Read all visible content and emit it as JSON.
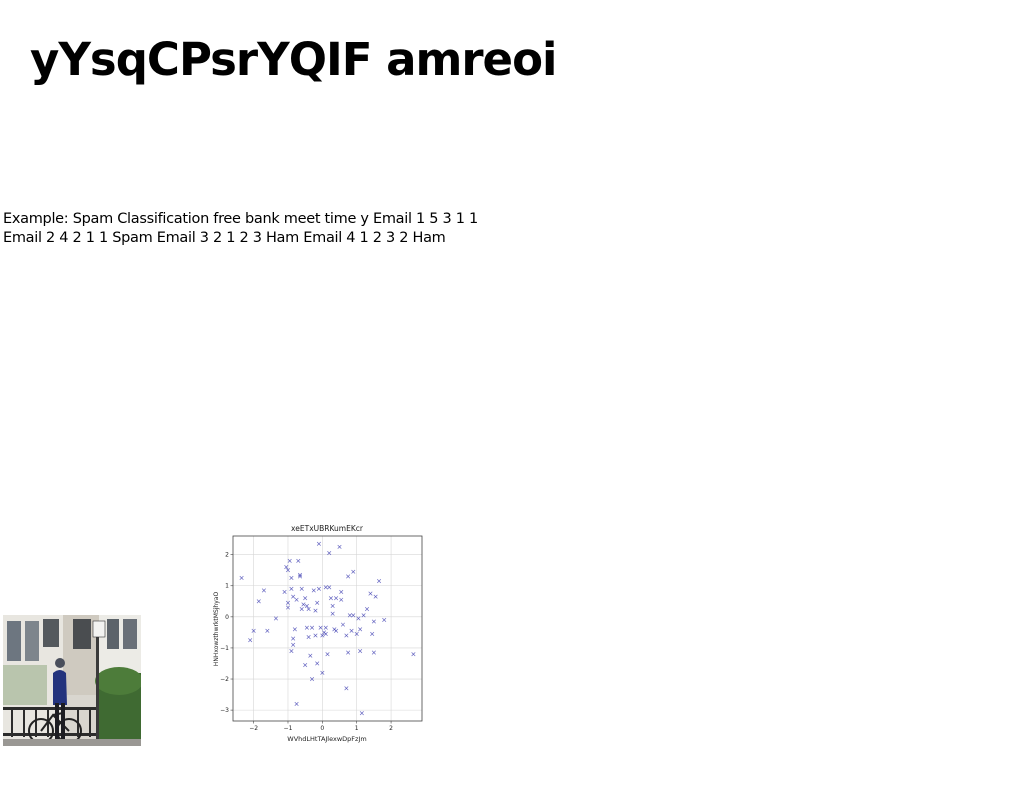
{
  "title": "yYsqCPsrYQIF amreoi",
  "body_text": "Example: Spam Classification free bank meet time y Email 1 5 3 1 1 Email 2 4 2 1 1 Spam Email 3 2 1 2 3 Ham Email 4 1 2 3 2 Ham",
  "colors": {
    "marker": "#3b3bb0",
    "grid": "#d6d6d6",
    "axes": "#444444"
  },
  "chart_data": {
    "type": "scatter",
    "title": "xeETxUBRKumEKcr",
    "xlabel": "WVhdLHtTAJlexwDpFzJm",
    "ylabel": "HNHxowzthwrktMSjhyaO",
    "xlim": [
      -2.6,
      2.9
    ],
    "ylim": [
      -3.35,
      2.6
    ],
    "xticks": [
      -2,
      -1,
      0,
      1,
      2
    ],
    "yticks": [
      2,
      1,
      0,
      -1,
      -2,
      -3
    ],
    "grid": true,
    "marker": "x",
    "x": [
      -2.35,
      -2.1,
      -2.0,
      -1.85,
      -1.7,
      -1.6,
      -1.35,
      -1.1,
      -1.05,
      -1.0,
      -1.0,
      -0.95,
      -0.9,
      -0.9,
      -0.85,
      -0.85,
      -0.8,
      -0.75,
      -0.7,
      -0.65,
      -0.6,
      -0.55,
      -0.5,
      -0.5,
      -0.45,
      -0.4,
      -0.4,
      -0.35,
      -0.3,
      -0.25,
      -0.2,
      -0.15,
      -0.1,
      -0.05,
      0.0,
      0.05,
      0.1,
      0.1,
      0.15,
      0.2,
      0.25,
      0.3,
      0.35,
      0.4,
      0.5,
      0.55,
      0.6,
      0.7,
      0.75,
      0.8,
      0.85,
      0.9,
      0.9,
      1.0,
      1.05,
      1.1,
      1.15,
      1.3,
      1.4,
      1.45,
      1.5,
      1.55,
      1.65,
      1.8,
      2.65,
      -1.0,
      -0.85,
      -0.65,
      -0.3,
      -0.15,
      0.1,
      -0.6,
      0.7,
      1.2,
      1.1,
      0.55,
      -0.1,
      0.3,
      -0.75,
      0.0,
      0.2,
      -0.45,
      -0.9,
      1.5,
      -0.2,
      0.75,
      0.4
    ],
    "y": [
      1.25,
      -0.75,
      -0.45,
      0.5,
      0.85,
      -0.45,
      -0.05,
      0.8,
      1.6,
      0.45,
      0.3,
      1.8,
      1.25,
      -1.1,
      0.65,
      -0.9,
      -0.4,
      0.55,
      1.8,
      1.3,
      0.25,
      0.4,
      -1.55,
      0.6,
      -0.35,
      -0.65,
      0.25,
      -1.25,
      -2.0,
      0.85,
      -0.6,
      -1.5,
      0.9,
      -0.35,
      -1.8,
      -0.5,
      0.95,
      -0.55,
      -1.2,
      2.05,
      0.6,
      0.35,
      -0.4,
      0.6,
      2.25,
      0.55,
      -0.25,
      -0.6,
      -1.15,
      0.05,
      -0.45,
      1.45,
      0.05,
      -0.55,
      -0.05,
      -1.1,
      -3.1,
      0.25,
      0.75,
      -0.55,
      -0.15,
      0.65,
      1.15,
      -0.1,
      -1.2,
      1.5,
      -0.7,
      1.35,
      -0.35,
      0.45,
      -0.35,
      0.9,
      -2.3,
      0.05,
      -0.4,
      0.8,
      2.35,
      0.1,
      -2.8,
      -0.6,
      0.95,
      0.35,
      0.9,
      -1.15,
      0.2,
      1.3,
      -0.45
    ]
  }
}
